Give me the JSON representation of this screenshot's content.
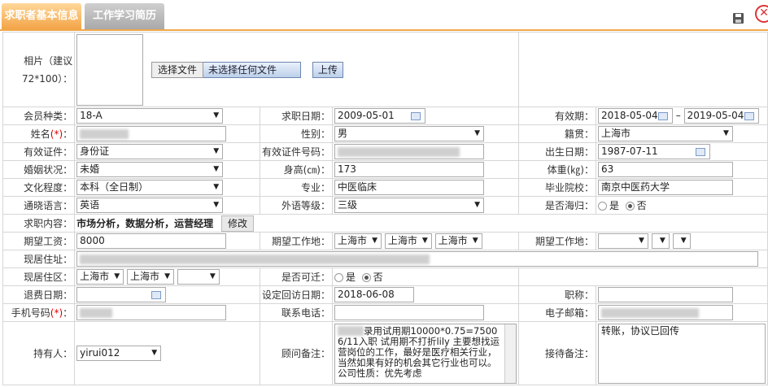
{
  "tabs": {
    "basic": "求职者基本信息",
    "resume": "工作学习简历"
  },
  "photo": {
    "label": "相片（建议72*100）：",
    "file_button": "选择文件",
    "file_status": "未选择任何文件",
    "upload": "上传"
  },
  "row1": {
    "member_label": "会员种类：",
    "member": "18-A",
    "apply_date_label": "求职日期：",
    "apply_date": "2009-05-01",
    "valid_label": "有效期：",
    "valid_from": "2018-05-04",
    "sep": "–",
    "valid_to": "2019-05-04"
  },
  "row2": {
    "name_label": "姓名",
    "req": "(*)",
    "colon": "：",
    "gender_label": "性别：",
    "gender": "男",
    "native_label": "籍贯：",
    "native": "上海市"
  },
  "row3": {
    "id_label": "有效证件：",
    "id_type": "身份证",
    "id_no_label": "有效证件号码：",
    "birth_label": "出生日期：",
    "birth": "1987-07-11"
  },
  "row4": {
    "marital_label": "婚姻状况：",
    "marital": "未婚",
    "height_label": "身高(㎝)：",
    "height": "173",
    "weight_label": "体重(㎏)：",
    "weight": "63"
  },
  "row5": {
    "edu_label": "文化程度：",
    "edu": "本科（全日制）",
    "major_label": "专业：",
    "major": "中医临床",
    "school_label": "毕业院校：",
    "school": "南京中医药大学"
  },
  "row6": {
    "lang_label": "通晓语言：",
    "lang": "英语",
    "lang_level_label": "外语等级：",
    "lang_level": "三级",
    "overseas_label": "是否海归：",
    "yes": "是",
    "no": "否"
  },
  "row7": {
    "content_label": "求职内容：",
    "content": "市场分析，数据分析，运营经理",
    "modify": "修改"
  },
  "row8": {
    "salary_label": "期望工资：",
    "salary": "8000",
    "workplace_label": "期望工作地：",
    "wp1": "上海市",
    "wp2": "上海市",
    "wp3": "上海市",
    "workplace2_label": "期望工作地："
  },
  "row9": {
    "address_label": "现居住址："
  },
  "row10": {
    "district_label": "现居住区：",
    "d1": "上海市",
    "d2": "上海市",
    "relocate_label": "是否可迁：",
    "yes": "是",
    "no": "否"
  },
  "row11": {
    "refund_label": "退费日期：",
    "revisit_label": "设定回访日期：",
    "revisit": "2018-06-08",
    "title_label": "职称："
  },
  "row12": {
    "phone_label": "手机号码",
    "req": "(*)",
    "colon": "：",
    "contact_label": "联系电话：",
    "email_label": "电子邮箱："
  },
  "row13": {
    "holder_label": "持有人：",
    "holder": "yirui012",
    "advisor_label": "顾问备注：",
    "advisor_note": "录用试用期10000*0.75=7500 6/11入职 试用期不打折lily 主要想找运营岗位的工作，最好是医疗相关行业，当然如果有好的机会其它行业也可以。公司性质：优先考虑",
    "reception_label": "接待备注：",
    "reception_note": "转账，协议已回传"
  }
}
